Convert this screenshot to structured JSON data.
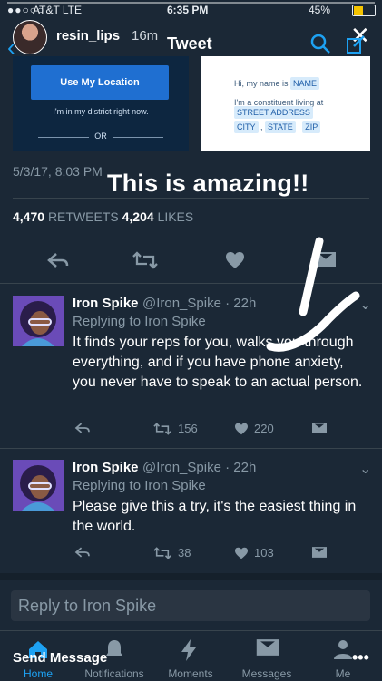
{
  "status_bar": {
    "carrier": "AT&T  LTE",
    "time": "6:35 PM",
    "battery": "45%"
  },
  "story": {
    "username": "resin_lips",
    "time": "16m",
    "close": "✕",
    "caption": "This is amazing!!",
    "send_message": "Send Message",
    "more": "•••"
  },
  "nav": {
    "title": "Tweet"
  },
  "embedded_image": {
    "use_location": "Use My Location",
    "in_district": "I'm in my district right now.",
    "or": "OR",
    "hi_name_pre": "Hi, my name is",
    "name_chip": "NAME",
    "constituent": "I'm a constituent living at",
    "street": "STREET ADDRESS",
    "city": "CITY",
    "state": "STATE",
    "zip": "ZIP"
  },
  "tweet": {
    "date": "5/3/17, 8:03 PM",
    "retweets_count": "4,470",
    "retweets_label": "RETWEETS",
    "likes_count": "4,204",
    "likes_label": "LIKES"
  },
  "replies": [
    {
      "name": "Iron Spike",
      "handle": "@Iron_Spike · 22h",
      "replying": "Replying to Iron Spike",
      "text": "It finds your reps for you, walks you through everything, and if you have phone anxiety, you never have to speak to an actual person.",
      "retweets": "156",
      "likes": "220"
    },
    {
      "name": "Iron Spike",
      "handle": "@Iron_Spike · 22h",
      "replying": "Replying to Iron Spike",
      "text": "Please give this a try, it's the easiest thing in the world.",
      "retweets": "38",
      "likes": "103"
    }
  ],
  "reply_box": {
    "placeholder": "Reply to Iron Spike"
  },
  "tabs": [
    {
      "label": "Home",
      "icon": "home-icon"
    },
    {
      "label": "Notifications",
      "icon": "bell-icon"
    },
    {
      "label": "Moments",
      "icon": "lightning-icon"
    },
    {
      "label": "Messages",
      "icon": "envelope-icon"
    },
    {
      "label": "Me",
      "icon": "person-icon"
    }
  ],
  "colors": {
    "background": "#1b2836",
    "accent": "#1da1f2",
    "muted": "#8899a6",
    "location_button": "#1f6fd1"
  }
}
